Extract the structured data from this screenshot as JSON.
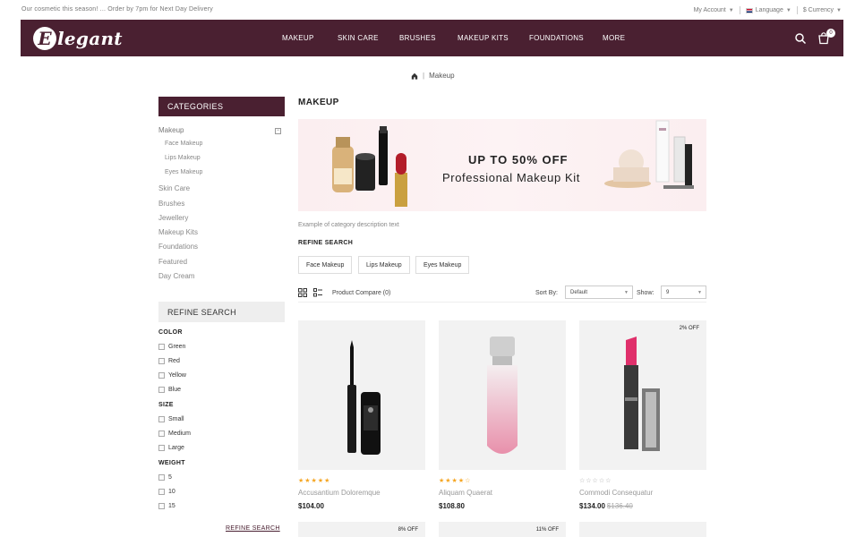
{
  "topbar": {
    "promo": "Our cosmetic this season! ... Order by 7pm for Next Day Delivery",
    "account": "My Account",
    "language": "Language",
    "currency": "$ Currency"
  },
  "header": {
    "logo_initial": "E",
    "logo_text": "legant",
    "nav": [
      "MAKEUP",
      "SKIN CARE",
      "BRUSHES",
      "MAKEUP KITS",
      "FOUNDATIONS",
      "MORE"
    ],
    "cart_count": "0",
    "icons": [
      "search-icon",
      "cart-icon"
    ]
  },
  "breadcrumb": {
    "home_icon": "home-icon",
    "sep": "|",
    "current": "Makeup"
  },
  "sidebar": {
    "categories_title": "CATEGORIES",
    "categories": [
      {
        "label": "Makeup",
        "sub": false
      },
      {
        "label": "Face Makeup",
        "sub": true
      },
      {
        "label": "Lips Makeup",
        "sub": true
      },
      {
        "label": "Eyes Makeup",
        "sub": true
      },
      {
        "label": "Skin Care",
        "sub": false
      },
      {
        "label": "Brushes",
        "sub": false
      },
      {
        "label": "Jewellery",
        "sub": false
      },
      {
        "label": "Makeup Kits",
        "sub": false
      },
      {
        "label": "Foundations",
        "sub": false
      },
      {
        "label": "Featured",
        "sub": false
      },
      {
        "label": "Day Cream",
        "sub": false
      }
    ],
    "collapse_symbol": "−",
    "refine_title": "REFINE SEARCH",
    "filters": {
      "color_title": "COLOR",
      "colors": [
        "Green",
        "Red",
        "Yellow",
        "Blue"
      ],
      "size_title": "SIZE",
      "sizes": [
        "Small",
        "Medium",
        "Large"
      ],
      "weight_title": "WEIGHT",
      "weights": [
        "5",
        "10",
        "15"
      ]
    },
    "refine_link": "REFINE SEARCH"
  },
  "main": {
    "title": "MAKEUP",
    "banner": {
      "line1": "UP TO 50% OFF",
      "line2": "Professional Makeup Kit"
    },
    "description": "Example of category description text",
    "refine_title": "REFINE SEARCH",
    "chips": [
      "Face Makeup",
      "Lips Makeup",
      "Eyes Makeup"
    ],
    "toolbar": {
      "compare": "Product Compare (0)",
      "sort_label": "Sort By:",
      "sort_value": "Default",
      "show_label": "Show:",
      "show_value": "9"
    }
  },
  "products": [
    {
      "name": "Accusantium Doloremque",
      "price": "$104.00",
      "old_price": "",
      "badge": "",
      "rating": 5,
      "stars": "★★★★★"
    },
    {
      "name": "Aliquam Quaerat",
      "price": "$108.80",
      "old_price": "",
      "badge": "",
      "rating": 4,
      "stars": "★★★★☆"
    },
    {
      "name": "Commodi Consequatur",
      "price": "$134.00",
      "old_price": "$136.40",
      "badge": "2% OFF",
      "rating": 0,
      "stars": "☆☆☆☆☆"
    }
  ],
  "next_row_badges": [
    "8% OFF",
    "11% OFF"
  ],
  "colors": {
    "brand": "#4a2031",
    "star": "#f5a623"
  }
}
